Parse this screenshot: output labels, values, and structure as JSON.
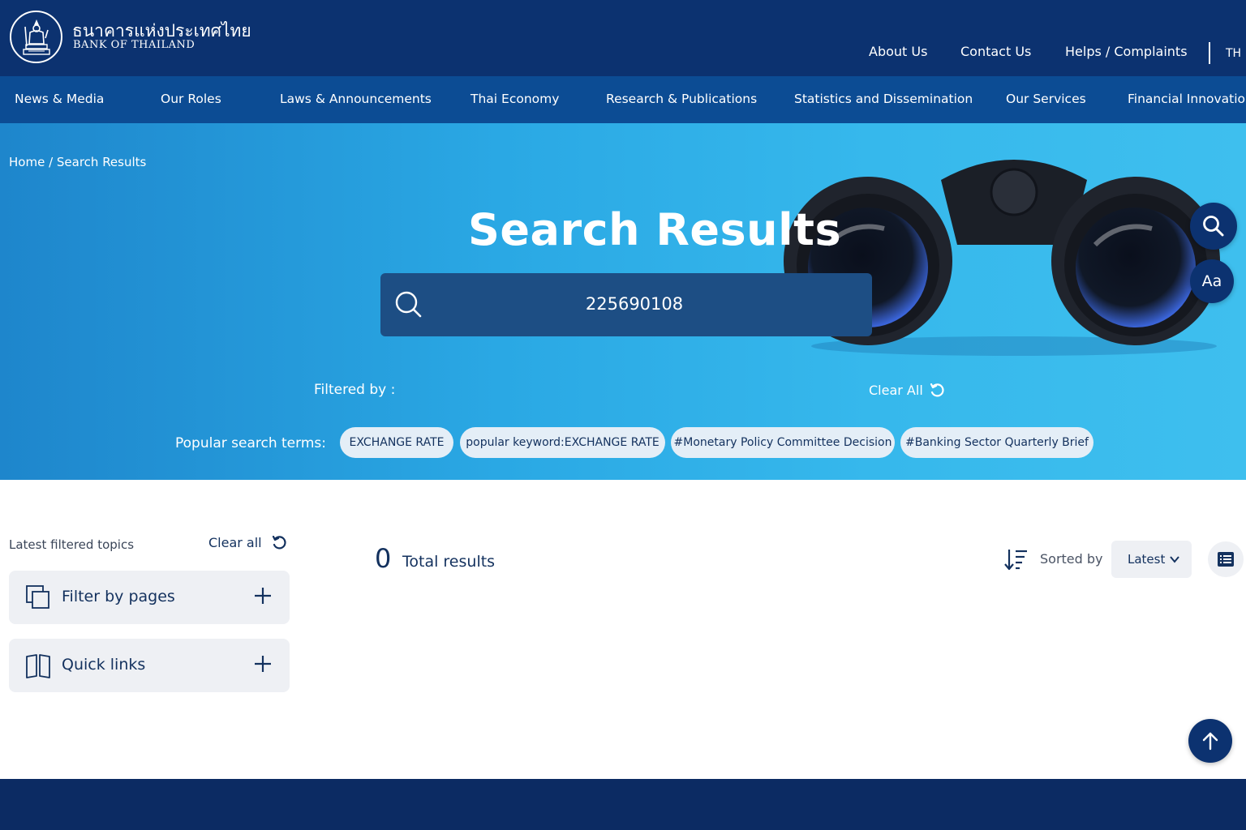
{
  "header": {
    "brand_thai": "ธนาคารแห่งประเทศไทย",
    "brand_english": "BANK OF THAILAND",
    "top_links": [
      "About Us",
      "Contact Us",
      "Helps / Complaints"
    ],
    "language": "TH"
  },
  "nav": {
    "items": [
      "News & Media",
      "Our Roles",
      "Laws & Announcements",
      "Thai Economy",
      "Research & Publications",
      "Statistics and Dissemination",
      "Our Services",
      "Financial Innovation"
    ]
  },
  "hero": {
    "breadcrumb": "Home / Search Results",
    "title": "Search Results",
    "search_value": "225690108",
    "filtered_by_label": "Filtered by :",
    "clear_all_label": "Clear All",
    "popular_label": "Popular search terms:",
    "popular_terms": [
      "EXCHANGE RATE",
      "popular keyword:EXCHANGE RATE",
      "#Monetary Policy Committee Decision",
      "#Banking Sector Quarterly Brief"
    ]
  },
  "sidebar": {
    "latest_label": "Latest filtered topics",
    "clear_label": "Clear all",
    "filters": [
      "Filter by pages",
      "Quick links"
    ]
  },
  "results": {
    "count": "0",
    "count_label": "Total results",
    "sorted_label": "Sorted by",
    "sort_value": "Latest"
  },
  "floating": {
    "text_size_label": "Aa"
  },
  "colors": {
    "header_bg": "#0c3270",
    "nav_bg": "#0c4c94",
    "hero_blue": "#2aa8e4",
    "accent_navy": "#13315e",
    "footer_bg": "#0c2b63"
  },
  "icons": [
    "emblem-logo",
    "search-icon",
    "refresh-icon",
    "pages-icon",
    "book-icon",
    "plus-icon",
    "sort-icon",
    "chevron-down-icon",
    "list-view-icon",
    "arrow-up-icon",
    "text-size-icon"
  ]
}
